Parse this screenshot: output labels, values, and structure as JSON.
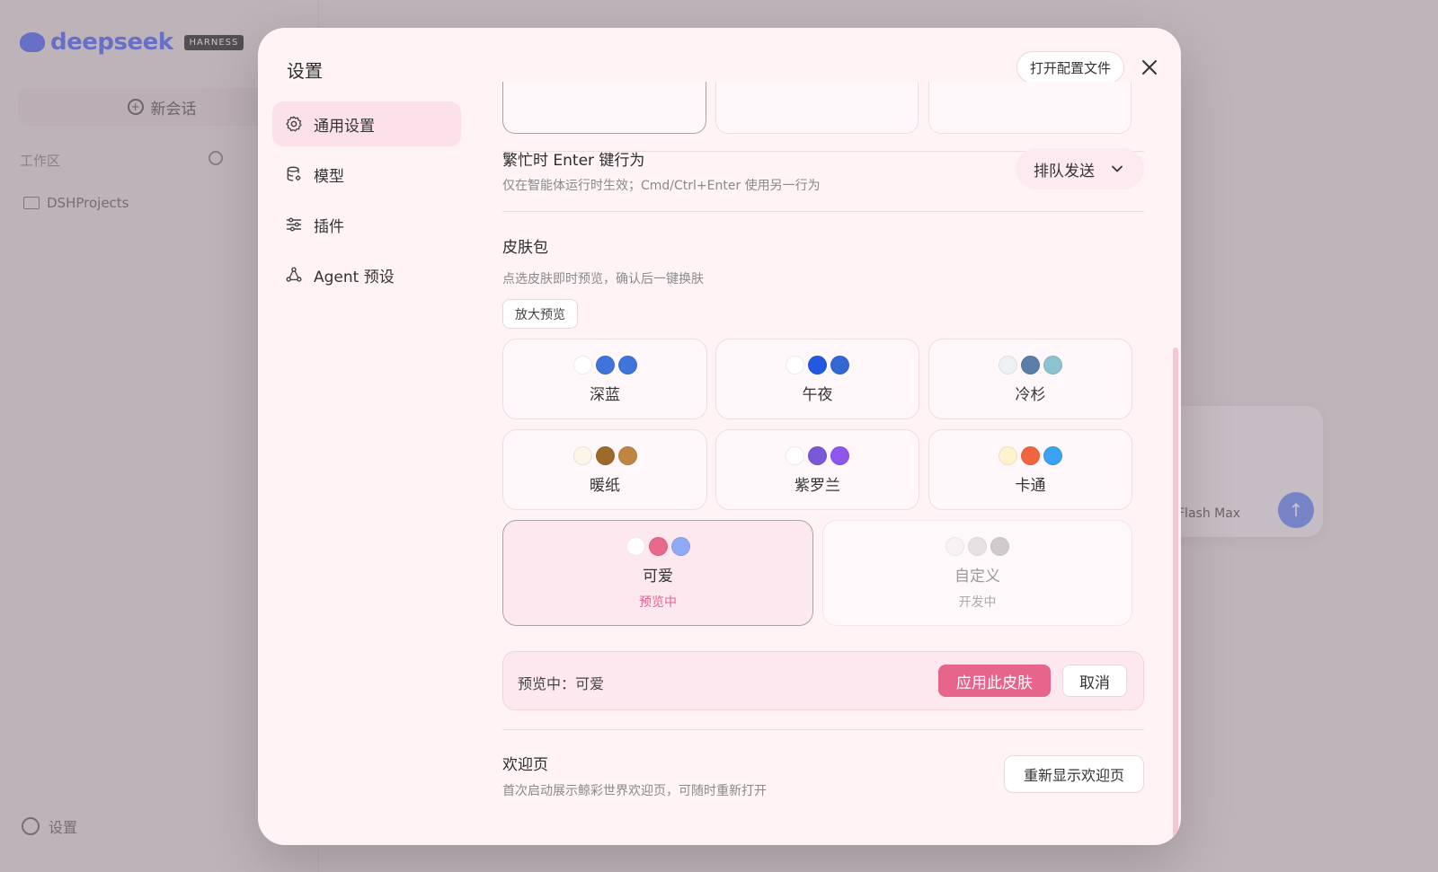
{
  "background": {
    "brand": "deepseek",
    "brand_tag": "HARNESS",
    "new_chat": "新会话",
    "workspace": "工作区",
    "folder": "DSHProjects",
    "settings": "设置",
    "composer_model": "Flash Max"
  },
  "modal": {
    "title": "设置",
    "open_config": "打开配置文件"
  },
  "nav": {
    "items": [
      {
        "label": "通用设置",
        "icon": "gear-icon",
        "active": true
      },
      {
        "label": "模型",
        "icon": "database-icon",
        "active": false
      },
      {
        "label": "插件",
        "icon": "sliders-icon",
        "active": false
      },
      {
        "label": "Agent 预设",
        "icon": "network-icon",
        "active": false
      }
    ]
  },
  "busy_enter": {
    "title": "繁忙时 Enter 键行为",
    "desc": "仅在智能体运行时生效；Cmd/Ctrl+Enter 使用另一行为",
    "value": "排队发送"
  },
  "skins": {
    "title": "皮肤包",
    "desc": "点选皮肤即时预览，确认后一键换肤",
    "zoom_button": "放大预览",
    "items": [
      {
        "name": "深蓝",
        "colors": [
          "#ffffff",
          "#3f74db",
          "#3f74db"
        ]
      },
      {
        "name": "午夜",
        "colors": [
          "#ffffff",
          "#2359e0",
          "#3368d2"
        ]
      },
      {
        "name": "冷杉",
        "colors": [
          "#eef1f4",
          "#5b7ea8",
          "#8cc3cf"
        ]
      },
      {
        "name": "暖纸",
        "colors": [
          "#fbf6e8",
          "#9c6a2b",
          "#bf8641"
        ]
      },
      {
        "name": "紫罗兰",
        "colors": [
          "#ffffff",
          "#7a58d6",
          "#8f55ec"
        ]
      },
      {
        "name": "卡通",
        "colors": [
          "#fff3cf",
          "#f0643f",
          "#3aa2f0"
        ]
      },
      {
        "name": "可爱",
        "colors": [
          "#ffffff",
          "#e76a8c",
          "#8fa9f6"
        ],
        "status": "预览中"
      },
      {
        "name": "自定义",
        "colors": [
          "#f4f0f2",
          "#dcd8da",
          "#bcb8ba"
        ],
        "status": "开发中"
      }
    ],
    "preview_label": "预览中：可爱",
    "apply": "应用此皮肤",
    "cancel": "取消"
  },
  "welcome": {
    "title": "欢迎页",
    "desc": "首次启动展示鲸彩世界欢迎页，可随时重新打开",
    "button": "重新显示欢迎页"
  },
  "colors": {
    "accent": "#e7648a",
    "active_nav_bg": "#fde1ea",
    "modal_bg": "#fff3f6"
  }
}
